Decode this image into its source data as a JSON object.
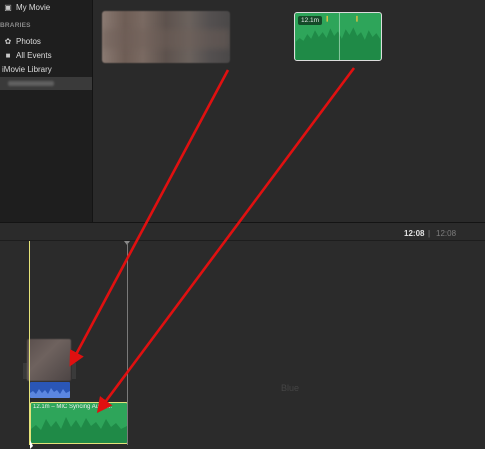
{
  "sidebar": {
    "project_title": "My Movie",
    "libraries_heading": "IBRARIES",
    "items": [
      {
        "label": "Photos",
        "icon": "photos-icon"
      },
      {
        "label": "All Events",
        "icon": "star-icon"
      },
      {
        "label": "iMovie Library",
        "icon": ""
      }
    ]
  },
  "browser": {
    "audio_clip_duration": "12.1m"
  },
  "timeline": {
    "current_time": "12:08",
    "separator": "|",
    "total_time": "12:08",
    "audio_clip_label": "12.1m – MIC Syncing Audio...",
    "watermark": "Blue"
  },
  "colors": {
    "audio_green": "#2ea55a",
    "detached_audio_blue": "#2a56b6",
    "playhead_yellow": "#e7e57a",
    "annotation_red": "#e01010"
  }
}
